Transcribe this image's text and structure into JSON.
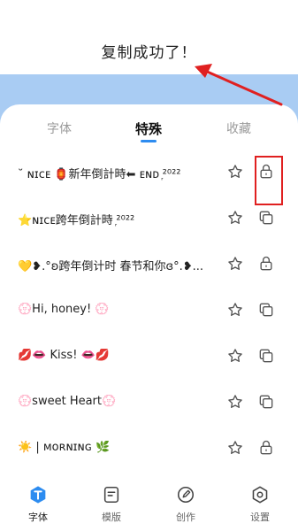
{
  "toast": {
    "message": "复制成功了！"
  },
  "tabs": [
    {
      "label": "字体"
    },
    {
      "label": "特殊"
    },
    {
      "label": "收藏"
    }
  ],
  "rows": [
    {
      "text": "˘ ɴɪᴄᴇ 🏮新年倒計時⬅ ᴇɴᴅ ᷊²⁰²²",
      "action": "lock"
    },
    {
      "text": "⭐ɴɪᴄᴇ跨年倒計時 ᷊²⁰²²",
      "action": "copy"
    },
    {
      "text": "💛❥.°ʚ跨年倒计时 春节和你ɞ°.❥...",
      "action": "lock"
    },
    {
      "text": "💮Hi, honey! 💮",
      "action": "copy"
    },
    {
      "text": "💋👄 Kiss! 👄💋",
      "action": "copy"
    },
    {
      "text": "💮sweet Heart💮",
      "action": "copy"
    },
    {
      "text": "☀️ | ᴍᴏʀɴɪɴɢ 🌿",
      "action": "lock"
    }
  ],
  "nav": [
    {
      "label": "字体",
      "icon": "font-icon"
    },
    {
      "label": "模版",
      "icon": "template-icon"
    },
    {
      "label": "创作",
      "icon": "pen-icon"
    },
    {
      "label": "设置",
      "icon": "settings-icon"
    }
  ],
  "colors": {
    "accent": "#2d8cf0",
    "band": "#a9ccf3",
    "annotation": "#e02020"
  }
}
